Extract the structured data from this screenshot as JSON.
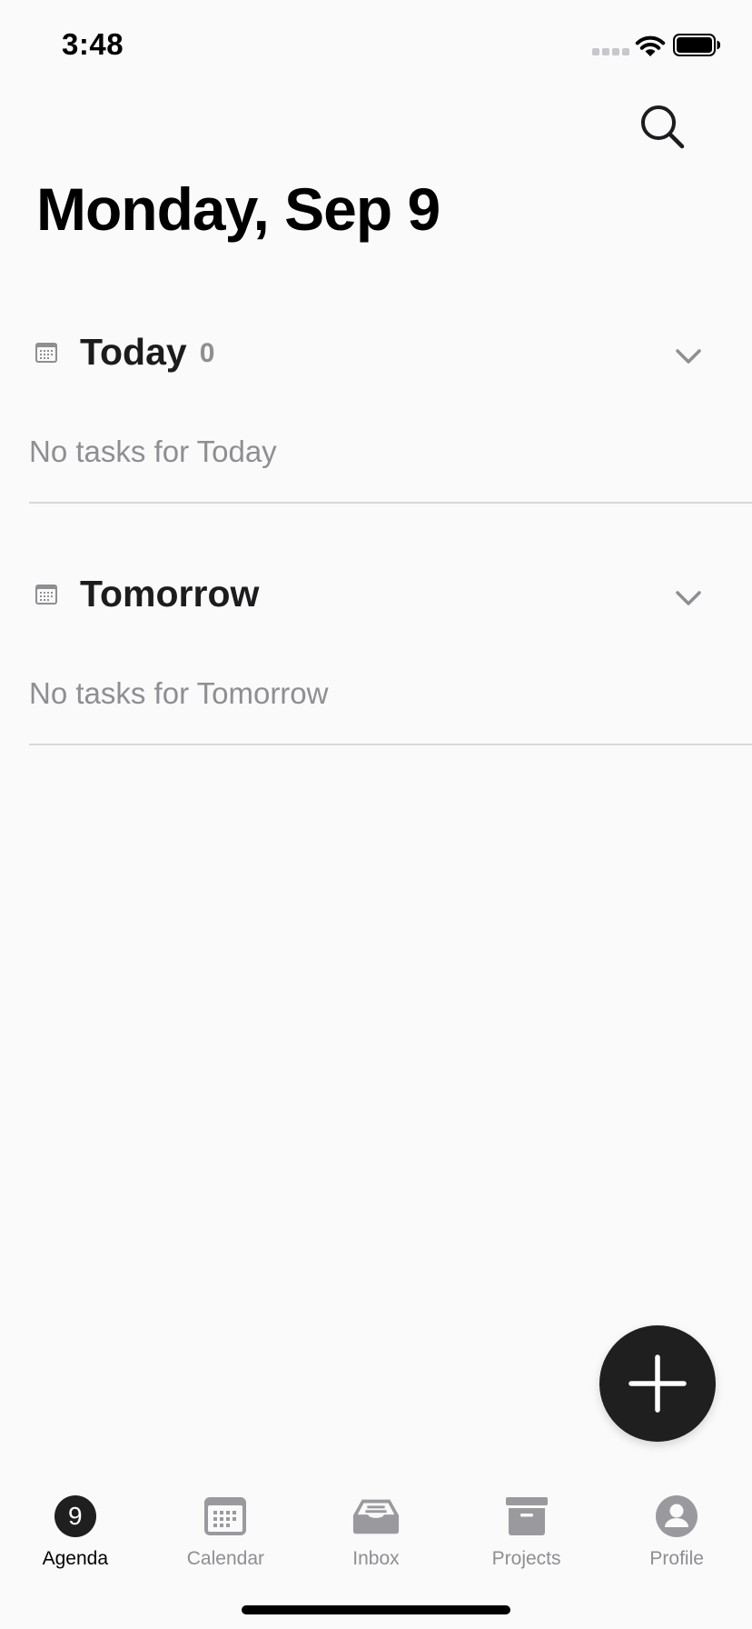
{
  "status_bar": {
    "time": "3:48"
  },
  "header": {
    "title": "Monday, Sep 9",
    "search_icon": "search-icon"
  },
  "sections": [
    {
      "title": "Today",
      "count": "0",
      "empty_text": "No tasks for Today",
      "icon": "calendar-icon"
    },
    {
      "title": "Tomorrow",
      "empty_text": "No tasks for Tomorrow",
      "icon": "calendar-icon"
    }
  ],
  "fab": {
    "icon": "plus-icon"
  },
  "tab_bar": {
    "agenda_badge": "9",
    "items": [
      {
        "label": "Agenda",
        "icon": "agenda-badge-icon",
        "active": true
      },
      {
        "label": "Calendar",
        "icon": "calendar-icon",
        "active": false
      },
      {
        "label": "Inbox",
        "icon": "inbox-icon",
        "active": false
      },
      {
        "label": "Projects",
        "icon": "archive-box-icon",
        "active": false
      },
      {
        "label": "Profile",
        "icon": "profile-icon",
        "active": false
      }
    ]
  },
  "colors": {
    "background": "#fafafa",
    "text_primary": "#1c1c1e",
    "text_secondary": "#8e8e93",
    "fab": "#1f1f1f",
    "divider": "#d8d8dc"
  }
}
